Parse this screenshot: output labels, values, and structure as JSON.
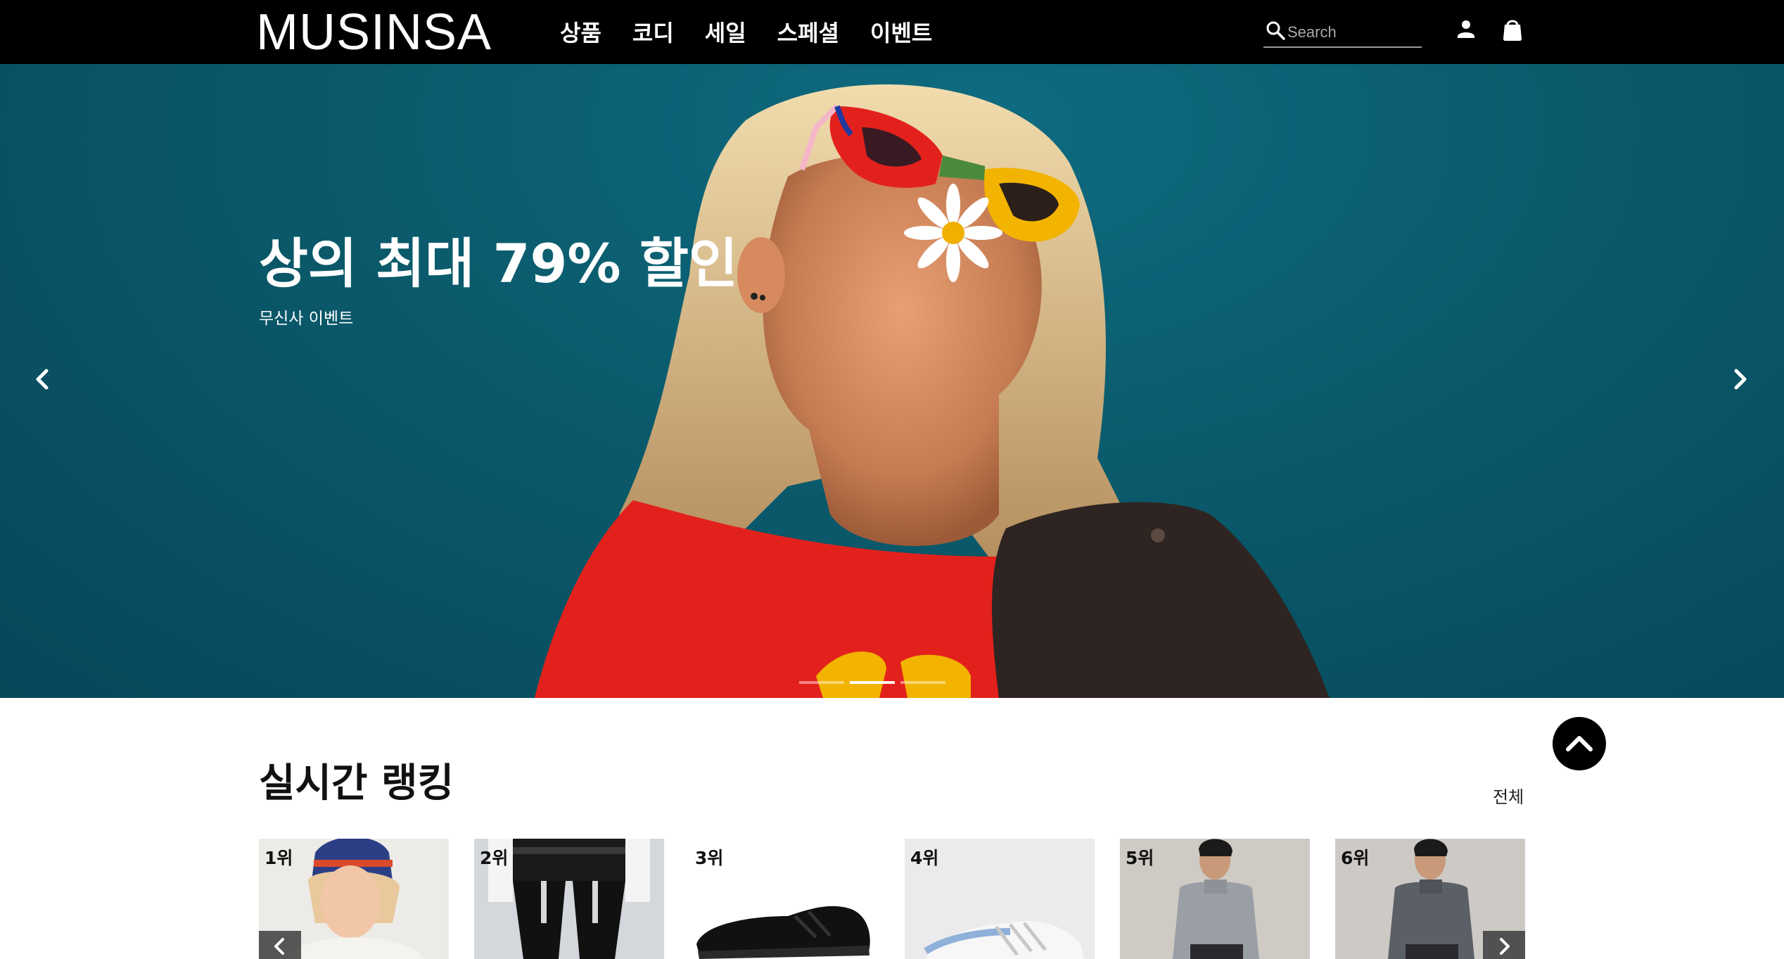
{
  "header": {
    "logo": "MUSINSA",
    "nav": [
      "상품",
      "코디",
      "세일",
      "스페셜",
      "이벤트"
    ],
    "search_placeholder": "Search",
    "icons": [
      "search-icon",
      "user-icon",
      "shopping-bag-icon"
    ]
  },
  "hero": {
    "title": "상의 최대 79% 할인",
    "subtitle": "무신사 이벤트",
    "slide_count": 3,
    "active_slide": 2
  },
  "ranking": {
    "title": "실시간 랭킹",
    "see_all": "전체",
    "items": [
      {
        "rank": "1위"
      },
      {
        "rank": "2위"
      },
      {
        "rank": "3위"
      },
      {
        "rank": "4위"
      },
      {
        "rank": "5위"
      },
      {
        "rank": "6위"
      }
    ]
  },
  "colors": {
    "header_bg": "#000000",
    "hero_bg": "#0a5a6b",
    "accent_red": "#e3211c"
  }
}
